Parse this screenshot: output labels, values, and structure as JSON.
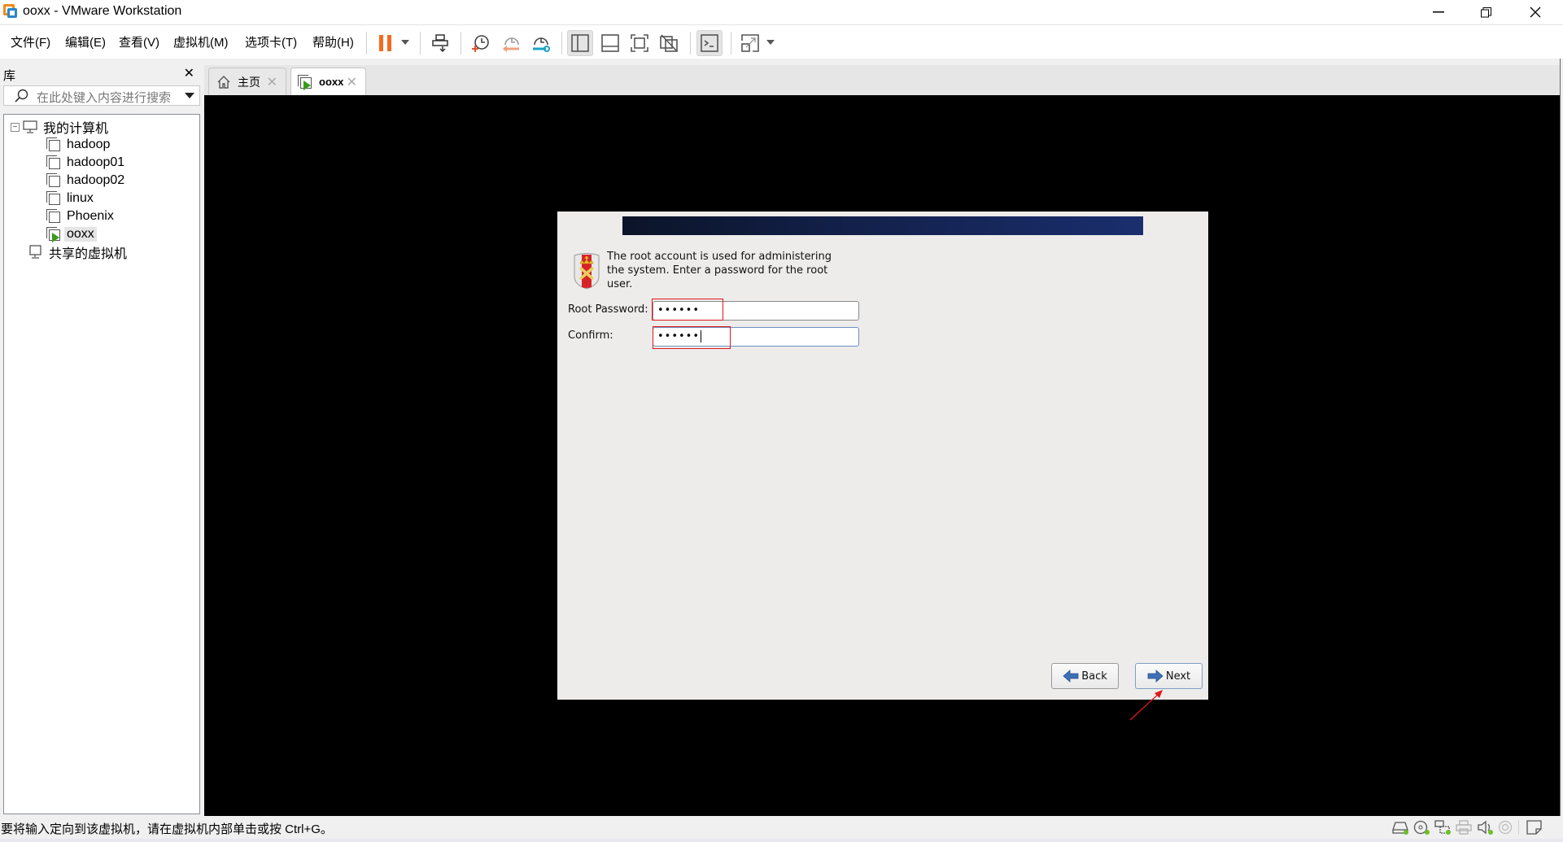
{
  "window": {
    "title": "ooxx - VMware Workstation",
    "controls": {
      "minimize": "—",
      "restore": "❐",
      "close": "✕"
    }
  },
  "menu": {
    "items": [
      "文件(F)",
      "编辑(E)",
      "查看(V)",
      "虚拟机(M)",
      "选项卡(T)",
      "帮助(H)"
    ]
  },
  "toolbar": {
    "buttons": [
      {
        "name": "pause-icon",
        "label": "Suspend/Pause"
      },
      {
        "name": "send-ctrl-alt-del-icon",
        "label": "Send Ctrl+Alt+Del"
      },
      {
        "name": "take-snapshot-icon",
        "label": "Take snapshot"
      },
      {
        "name": "revert-snapshot-icon",
        "label": "Revert snapshot"
      },
      {
        "name": "snapshot-manager-icon",
        "label": "Snapshot manager"
      },
      {
        "name": "show-library-icon",
        "label": "Show library",
        "active": true
      },
      {
        "name": "thumbnail-bar-icon",
        "label": "Thumbnail bar"
      },
      {
        "name": "fullscreen-icon",
        "label": "Full screen"
      },
      {
        "name": "unity-icon",
        "label": "Unity"
      },
      {
        "name": "console-view-icon",
        "label": "Console view",
        "active": true
      },
      {
        "name": "stretch-guest-icon",
        "label": "Stretch guest"
      }
    ]
  },
  "library": {
    "title": "库",
    "close": "✕",
    "search_placeholder": "在此处键入内容进行搜索",
    "tree": {
      "root": "我的计算机",
      "vms": [
        "hadoop",
        "hadoop01",
        "hadoop02",
        "linux",
        "Phoenix",
        "ooxx"
      ],
      "selected": "ooxx",
      "shared": "共享的虚拟机"
    }
  },
  "tabs": [
    {
      "label": "主页",
      "icon": "home-icon",
      "active": false
    },
    {
      "label": "ooxx",
      "icon": "vm-running-icon",
      "active": true
    }
  ],
  "installer": {
    "intro": "The root account is used for administering the system.  Enter a password for the root user.",
    "root_password_label": "Root Password:",
    "root_password_value": "••••••",
    "confirm_label": "Confirm:",
    "confirm_value": "••••••",
    "back_label": "Back",
    "next_label": "Next"
  },
  "statusbar": {
    "message": "要将输入定向到该虚拟机，请在虚拟机内部单击或按 Ctrl+G。",
    "devices": [
      {
        "name": "hard-disk-icon",
        "connected": true
      },
      {
        "name": "cd-dvd-icon",
        "connected": true
      },
      {
        "name": "network-adapter-icon",
        "connected": true
      },
      {
        "name": "printer-icon",
        "connected": false
      },
      {
        "name": "sound-card-icon",
        "connected": true
      },
      {
        "name": "camera-icon",
        "connected": false
      },
      {
        "name": "message-log-icon",
        "connected": false
      }
    ]
  },
  "colors": {
    "annotation_red": "#e01818",
    "pause_orange": "#f26b21",
    "running_green": "#3a9a1c",
    "device_active_green": "#6cc024",
    "banner_dark": "#0b1428",
    "banner_blue": "#1a2e6e"
  }
}
